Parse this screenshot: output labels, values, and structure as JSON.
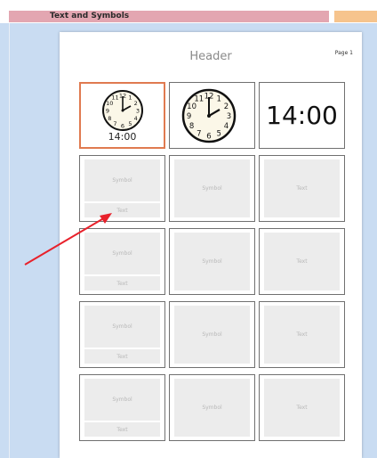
{
  "toolbar": {
    "tab_label": "Text and Symbols"
  },
  "page": {
    "header": "Header",
    "page_number": "Page 1"
  },
  "row1": {
    "clock_time_label": "14:00",
    "big_time": "14:00",
    "clock_numbers": [
      "12",
      "1",
      "2",
      "3",
      "4",
      "5",
      "6",
      "7",
      "8",
      "9",
      "10",
      "11"
    ]
  },
  "cells": {
    "symbol": "Symbol",
    "text": "Text"
  },
  "colors": {
    "selection": "#e07a50",
    "arrow": "#e8212b",
    "tab_pink": "#e3a6b1",
    "tab_peach": "#f6c48d"
  }
}
